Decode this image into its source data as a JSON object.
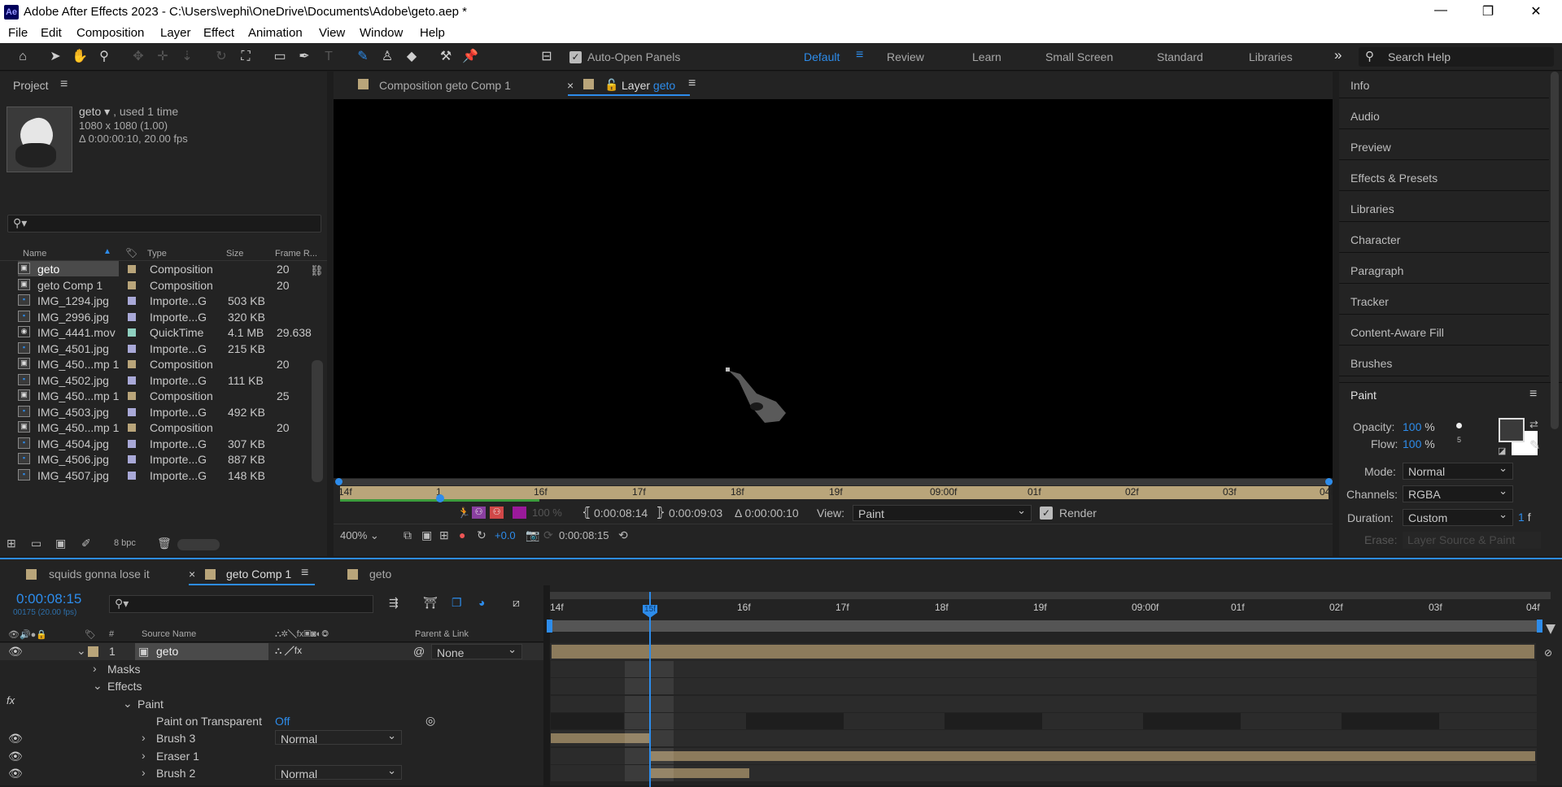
{
  "window": {
    "logo": "Ae",
    "title": "Adobe After Effects 2023 - C:\\Users\\vephi\\OneDrive\\Documents\\Adobe\\geto.aep *",
    "minimize": "—",
    "maximize": "❐",
    "close": "✕"
  },
  "menu": [
    "File",
    "Edit",
    "Composition",
    "Layer",
    "Effect",
    "Animation",
    "View",
    "Window",
    "Help"
  ],
  "toolbar": {
    "auto_open": "Auto-Open Panels",
    "workspaces": [
      "Default",
      "Review",
      "Learn",
      "Small Screen",
      "Standard",
      "Libraries"
    ],
    "search_placeholder": "Search Help",
    "more": "»"
  },
  "project": {
    "title": "Project",
    "item_name": "geto",
    "used": ", used 1 time",
    "dims": "1080 x 1080 (1.00)",
    "duration": "Δ 0:00:00:10, 20.00 fps",
    "columns": [
      "Name",
      "Type",
      "Size",
      "Frame R..."
    ],
    "bpc": "8 bpc",
    "rows": [
      {
        "name": "geto",
        "type": "Composition",
        "size": "",
        "fr": "20",
        "color": "#b9a57a",
        "kind": "comp"
      },
      {
        "name": "geto Comp 1",
        "type": "Composition",
        "size": "",
        "fr": "20",
        "color": "#b9a57a",
        "kind": "comp"
      },
      {
        "name": "IMG_1294.jpg",
        "type": "Importe...G",
        "size": "503 KB",
        "fr": "",
        "color": "#a9a9d8",
        "kind": "img"
      },
      {
        "name": "IMG_2996.jpg",
        "type": "Importe...G",
        "size": "320 KB",
        "fr": "",
        "color": "#a9a9d8",
        "kind": "img"
      },
      {
        "name": "IMG_4441.mov",
        "type": "QuickTime",
        "size": "4.1 MB",
        "fr": "29.638",
        "color": "#8fd0c0",
        "kind": "mov"
      },
      {
        "name": "IMG_4501.jpg",
        "type": "Importe...G",
        "size": "215 KB",
        "fr": "",
        "color": "#a9a9d8",
        "kind": "img"
      },
      {
        "name": "IMG_450...mp 1",
        "type": "Composition",
        "size": "",
        "fr": "20",
        "color": "#b9a57a",
        "kind": "comp"
      },
      {
        "name": "IMG_4502.jpg",
        "type": "Importe...G",
        "size": "111 KB",
        "fr": "",
        "color": "#a9a9d8",
        "kind": "img"
      },
      {
        "name": "IMG_450...mp 1",
        "type": "Composition",
        "size": "",
        "fr": "25",
        "color": "#b9a57a",
        "kind": "comp"
      },
      {
        "name": "IMG_4503.jpg",
        "type": "Importe...G",
        "size": "492 KB",
        "fr": "",
        "color": "#a9a9d8",
        "kind": "img"
      },
      {
        "name": "IMG_450...mp 1",
        "type": "Composition",
        "size": "",
        "fr": "20",
        "color": "#b9a57a",
        "kind": "comp"
      },
      {
        "name": "IMG_4504.jpg",
        "type": "Importe...G",
        "size": "307 KB",
        "fr": "",
        "color": "#a9a9d8",
        "kind": "img"
      },
      {
        "name": "IMG_4506.jpg",
        "type": "Importe...G",
        "size": "887 KB",
        "fr": "",
        "color": "#a9a9d8",
        "kind": "img"
      },
      {
        "name": "IMG_4507.jpg",
        "type": "Importe...G",
        "size": "148 KB",
        "fr": "",
        "color": "#a9a9d8",
        "kind": "img"
      }
    ]
  },
  "viewer": {
    "tab1": "Composition geto Comp 1",
    "tab2_prefix": "Layer",
    "tab2_name": "geto",
    "ruler": [
      "14f",
      "1",
      "16f",
      "17f",
      "18f",
      "19f",
      "09:00f",
      "01f",
      "02f",
      "03f",
      "04f"
    ],
    "opacity": "100 %",
    "in": "0:00:08:14",
    "out": "0:00:09:03",
    "dur": "Δ 0:00:00:10",
    "view_label": "View:",
    "view_value": "Paint",
    "render": "Render",
    "zoom": "400%",
    "exposure": "+0.0",
    "time": "0:00:08:15"
  },
  "right_panels": [
    "Info",
    "Audio",
    "Preview",
    "Effects & Presets",
    "Libraries",
    "Character",
    "Paragraph",
    "Tracker",
    "Content-Aware Fill",
    "Brushes"
  ],
  "paint": {
    "title": "Paint",
    "opacity_label": "Opacity:",
    "opacity": "100",
    "flow_label": "Flow:",
    "flow": "100",
    "pct": "%",
    "brush_size": "5",
    "mode_label": "Mode:",
    "mode": "Normal",
    "channels_label": "Channels:",
    "channels": "RGBA",
    "duration_label": "Duration:",
    "duration": "Custom",
    "duration_val": "1",
    "duration_unit": "f",
    "erase_label": "Erase:",
    "erase": "Layer Source & Paint"
  },
  "timeline": {
    "tabs": [
      "squids gonna lose it",
      "geto Comp 1",
      "geto"
    ],
    "time": "0:00:08:15",
    "frames": "00175 (20.00 fps)",
    "col_num": "#",
    "col_source": "Source Name",
    "col_parent": "Parent & Link",
    "ruler": [
      "14f",
      "16f",
      "17f",
      "18f",
      "19f",
      "09:00f",
      "01f",
      "02f",
      "03f",
      "04f"
    ],
    "playhead_label": "15f",
    "layer": {
      "num": "1",
      "name": "geto",
      "parent": "None"
    },
    "rows": [
      {
        "label": "Masks",
        "indent": 118,
        "arrow": "›"
      },
      {
        "label": "Effects",
        "indent": 118,
        "arrow": "⌄"
      },
      {
        "label": "Paint",
        "indent": 155,
        "arrow": "⌄"
      },
      {
        "label": "Paint on Transparent",
        "indent": 178,
        "arrow": "",
        "value": "Off"
      },
      {
        "label": "Brush 3",
        "indent": 178,
        "arrow": "›",
        "dropdown": "Normal"
      },
      {
        "label": "Eraser 1",
        "indent": 178,
        "arrow": "›"
      },
      {
        "label": "Brush 2",
        "indent": 178,
        "arrow": "›",
        "dropdown": "Normal"
      }
    ]
  }
}
